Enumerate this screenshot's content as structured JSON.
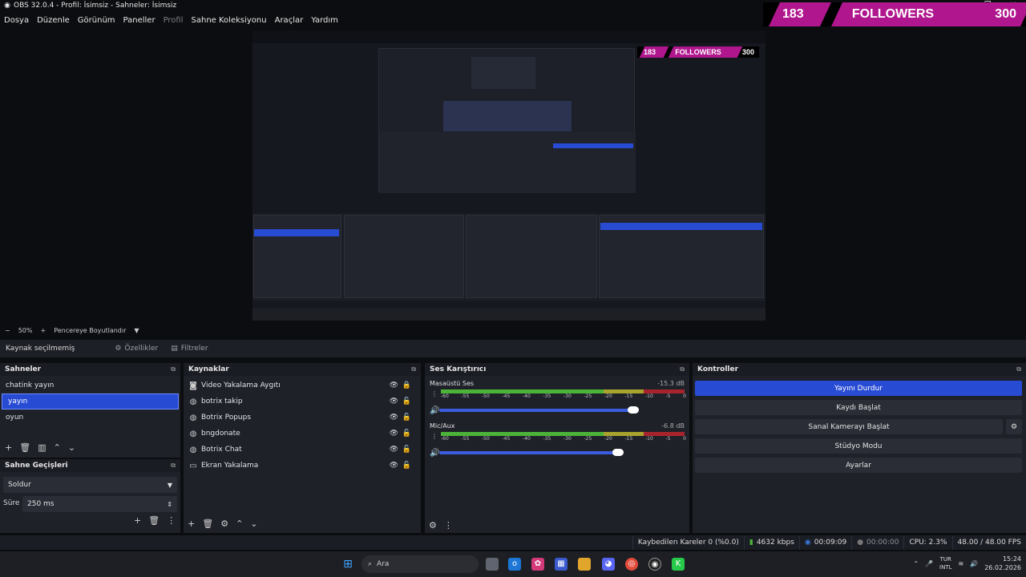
{
  "window": {
    "title": "OBS 32.0.4 - Profil: İsimsiz - Sahneler: İsimsiz",
    "minimize": "—",
    "maximize": "❐",
    "close": "✕"
  },
  "menu": [
    "Dosya",
    "Düzenle",
    "Görünüm",
    "Paneller",
    "Profil",
    "Sahne Koleksiyonu",
    "Araçlar",
    "Yardım"
  ],
  "ticker": {
    "left_value": "183",
    "label": "FOLLOWERS",
    "right_value": "300",
    "band_color": "#b0168d"
  },
  "preview_status": {
    "zoom_minus": "−",
    "zoom": "50%",
    "zoom_plus": "+",
    "fit": "Pencereye Boyutlandır",
    "fit_arrow": "▼"
  },
  "source_bar": {
    "label": "Kaynak seçilmemiş",
    "properties": "Özellikler",
    "filters": "Filtreler"
  },
  "scenes": {
    "title": "Sahneler",
    "items": [
      "chatink yayın",
      "yayın",
      "oyun"
    ],
    "selected_index": 1
  },
  "transitions": {
    "title": "Sahne Geçişleri",
    "type": "Soldur",
    "duration_label": "Süre",
    "duration_value": "250 ms"
  },
  "sources": {
    "title": "Kaynaklar",
    "items": [
      {
        "name": "Video Yakalama Aygıtı",
        "icon": "camera-icon",
        "glyph": "📷",
        "locked": true
      },
      {
        "name": "botrix takip",
        "icon": "browser-icon",
        "glyph": "◍",
        "locked": false
      },
      {
        "name": "Botrix Popups",
        "icon": "browser-icon",
        "glyph": "◍",
        "locked": false
      },
      {
        "name": "bngdonate",
        "icon": "browser-icon",
        "glyph": "◍",
        "locked": false
      },
      {
        "name": "Botrix Chat",
        "icon": "browser-icon",
        "glyph": "◍",
        "locked": false
      },
      {
        "name": "Ekran Yakalama",
        "icon": "monitor-icon",
        "glyph": "▭",
        "locked": false
      }
    ]
  },
  "mixer": {
    "title": "Ses Karıştırıcı",
    "ticks": [
      "-60",
      "-55",
      "-50",
      "-45",
      "-40",
      "-35",
      "-30",
      "-25",
      "-20",
      "-15",
      "-10",
      "-5",
      "0"
    ],
    "channels": [
      {
        "name": "Masaüstü Ses",
        "db": "-15.3 dB",
        "volume": 0.79
      },
      {
        "name": "Mic/Aux",
        "db": "-6.8 dB",
        "volume": 0.73
      }
    ]
  },
  "controls": {
    "title": "Kontroller",
    "buttons": [
      "Yayını Durdur",
      "Kaydı Başlat",
      "Sanal Kamerayı Başlat",
      "Stüdyo Modu",
      "Ayarlar"
    ]
  },
  "status_bar": {
    "dropped": "Kaybedilen Kareler 0 (%0.0)",
    "bitrate": "4632 kbps",
    "stream_time": "00:09:09",
    "rec_time": "00:00:00",
    "cpu": "CPU: 2.3%",
    "fps": "48.00 / 48.00 FPS"
  },
  "taskbar": {
    "search": "Ara",
    "lang_top": "TUR",
    "lang_bottom": "INTL",
    "time": "15:24",
    "date": "26.02.2026"
  },
  "colors": {
    "accent": "#284bd4",
    "meter_green": "#4cb339",
    "meter_yellow": "#a8a32c",
    "meter_red": "#a8242c"
  }
}
